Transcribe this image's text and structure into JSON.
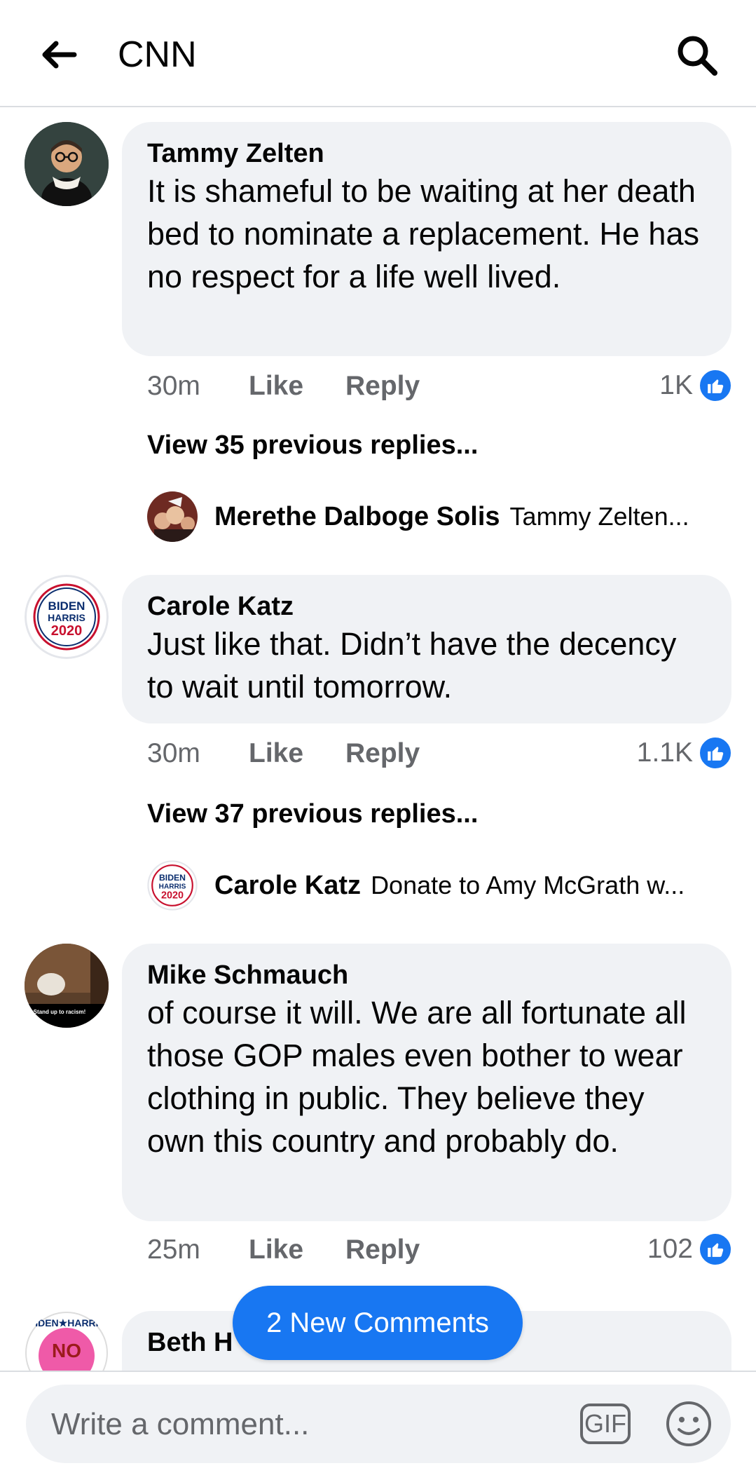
{
  "header": {
    "title": "CNN"
  },
  "comments": [
    {
      "author": "Tammy Zelten",
      "text": "It is shameful to be waiting at her death bed to nominate a replacement.  He has no respect for a life well lived.",
      "time": "30m",
      "like_label": "Like",
      "reply_label": "Reply",
      "reactions": "1K",
      "view_replies": "View 35 previous replies...",
      "reply_preview": {
        "author": "Merethe Dalboge Solis",
        "text": "Tammy Zelten..."
      }
    },
    {
      "author": "Carole Katz",
      "text": "Just like that. Didn’t have the decency to wait until tomorrow.",
      "time": "30m",
      "like_label": "Like",
      "reply_label": "Reply",
      "reactions": "1.1K",
      "view_replies": "View 37 previous replies...",
      "reply_preview": {
        "author": "Carole Katz",
        "text": "Donate to Amy McGrath w..."
      }
    },
    {
      "author": "Mike Schmauch",
      "text": "of course it will.  We are all fortunate all those GOP males even bother to wear clothing in public. They believe they own this country and probably do.",
      "time": "25m",
      "like_label": "Like",
      "reply_label": "Reply",
      "reactions": "102"
    },
    {
      "author": "Beth H"
    }
  ],
  "logos": {
    "biden_line1": "BIDEN",
    "biden_line2": "HARRIS",
    "biden_line3": "2020",
    "sticker_top": "BIDEN★HARRIS",
    "sticker_mid": "NO",
    "avatar3_caption": "Stand up to racism!"
  },
  "new_comments": "2 New Comments",
  "composer": {
    "placeholder": "Write a comment...",
    "gif_label": "GIF"
  },
  "colors": {
    "accent": "#1877f2",
    "bubble": "#f0f2f5",
    "secondary_text": "#65676b"
  }
}
